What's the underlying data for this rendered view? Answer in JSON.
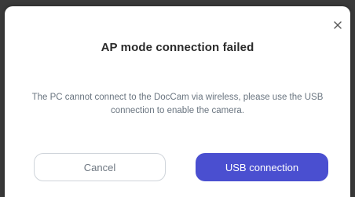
{
  "dialog": {
    "title": "AP mode connection failed",
    "message": "The PC cannot connect to the DocCam via wireless, please use the USB connection to enable the camera.",
    "close_icon": "close-icon",
    "buttons": {
      "cancel_label": "Cancel",
      "usb_label": "USB connection"
    }
  },
  "colors": {
    "primary": "#4a4fd0",
    "title_text": "#2a2a2a",
    "message_text": "#6a7580"
  }
}
